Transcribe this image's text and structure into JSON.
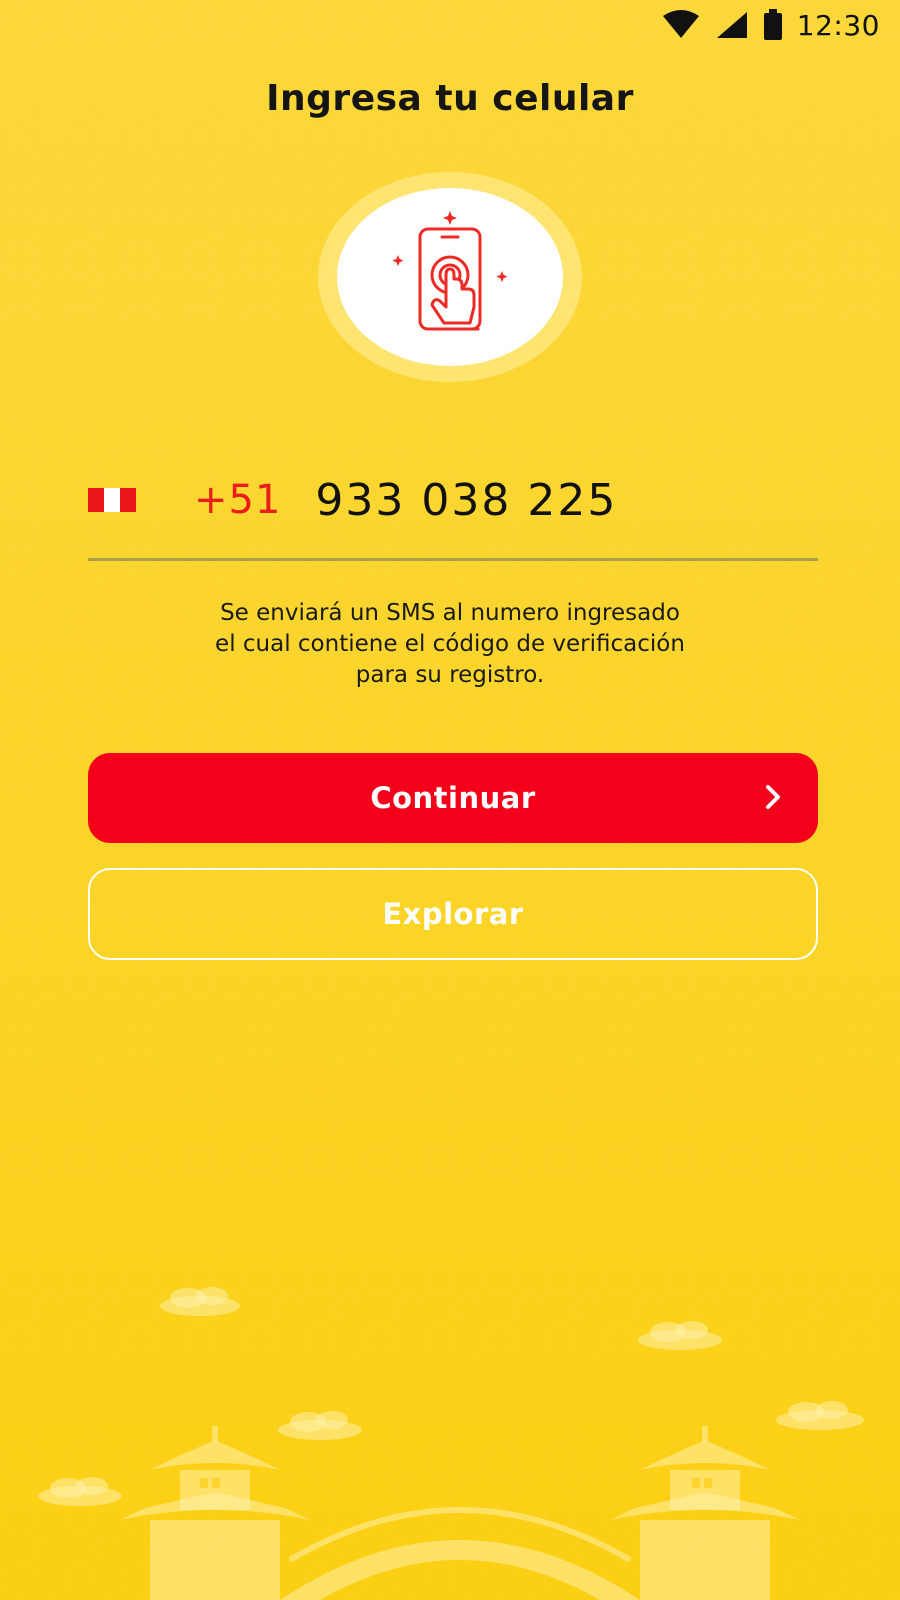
{
  "status_bar": {
    "time": "12:30",
    "icons": [
      "wifi-icon",
      "cell-signal-icon",
      "battery-icon"
    ]
  },
  "page": {
    "title": "Ingresa tu celular"
  },
  "illustration": {
    "icon": "phone-tap-icon"
  },
  "phone": {
    "country_flag": "peru-flag-icon",
    "country_code": "+51",
    "number": "933 038 225"
  },
  "sms_note": {
    "lines": [
      "Se enviará un SMS al numero ingresado",
      "el cual contiene el código de verificación",
      "para su registro."
    ]
  },
  "buttons": {
    "continue_label": "Continuar",
    "explore_label": "Explorar"
  },
  "colors": {
    "background": "#fbd428",
    "primary_red": "#f4001a",
    "country_code": "#ea1c1c",
    "underline": "#a8a04a"
  }
}
